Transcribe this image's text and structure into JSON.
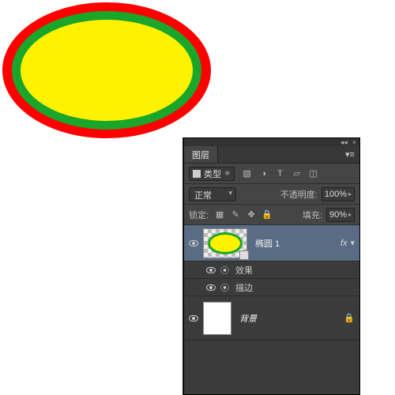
{
  "panel": {
    "title": "图层",
    "kind_label": "类型",
    "blend_mode": "正常",
    "opacity_label": "不透明度:",
    "opacity_value": "100%",
    "lock_label": "锁定:",
    "fill_label": "填充:",
    "fill_value": "90%"
  },
  "layers": [
    {
      "name": "椭圆 1",
      "fx": "fx",
      "effects_label": "效果",
      "stroke_label": "描边"
    },
    {
      "name": "背景"
    }
  ]
}
